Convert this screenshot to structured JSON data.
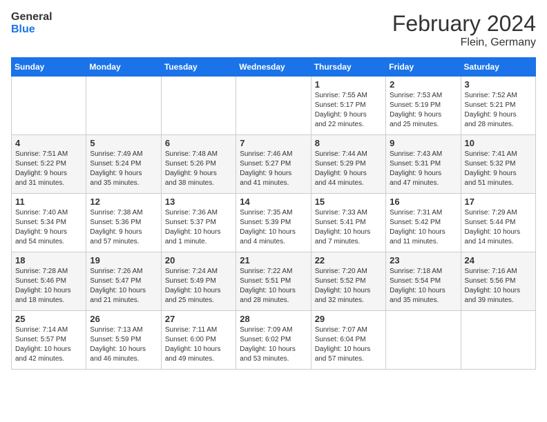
{
  "header": {
    "logo_text_general": "General",
    "logo_text_blue": "Blue",
    "title": "February 2024",
    "subtitle": "Flein, Germany"
  },
  "weekdays": [
    "Sunday",
    "Monday",
    "Tuesday",
    "Wednesday",
    "Thursday",
    "Friday",
    "Saturday"
  ],
  "weeks": [
    {
      "days": [
        {
          "num": "",
          "info": ""
        },
        {
          "num": "",
          "info": ""
        },
        {
          "num": "",
          "info": ""
        },
        {
          "num": "",
          "info": ""
        },
        {
          "num": "1",
          "info": "Sunrise: 7:55 AM\nSunset: 5:17 PM\nDaylight: 9 hours\nand 22 minutes."
        },
        {
          "num": "2",
          "info": "Sunrise: 7:53 AM\nSunset: 5:19 PM\nDaylight: 9 hours\nand 25 minutes."
        },
        {
          "num": "3",
          "info": "Sunrise: 7:52 AM\nSunset: 5:21 PM\nDaylight: 9 hours\nand 28 minutes."
        }
      ]
    },
    {
      "days": [
        {
          "num": "4",
          "info": "Sunrise: 7:51 AM\nSunset: 5:22 PM\nDaylight: 9 hours\nand 31 minutes."
        },
        {
          "num": "5",
          "info": "Sunrise: 7:49 AM\nSunset: 5:24 PM\nDaylight: 9 hours\nand 35 minutes."
        },
        {
          "num": "6",
          "info": "Sunrise: 7:48 AM\nSunset: 5:26 PM\nDaylight: 9 hours\nand 38 minutes."
        },
        {
          "num": "7",
          "info": "Sunrise: 7:46 AM\nSunset: 5:27 PM\nDaylight: 9 hours\nand 41 minutes."
        },
        {
          "num": "8",
          "info": "Sunrise: 7:44 AM\nSunset: 5:29 PM\nDaylight: 9 hours\nand 44 minutes."
        },
        {
          "num": "9",
          "info": "Sunrise: 7:43 AM\nSunset: 5:31 PM\nDaylight: 9 hours\nand 47 minutes."
        },
        {
          "num": "10",
          "info": "Sunrise: 7:41 AM\nSunset: 5:32 PM\nDaylight: 9 hours\nand 51 minutes."
        }
      ]
    },
    {
      "days": [
        {
          "num": "11",
          "info": "Sunrise: 7:40 AM\nSunset: 5:34 PM\nDaylight: 9 hours\nand 54 minutes."
        },
        {
          "num": "12",
          "info": "Sunrise: 7:38 AM\nSunset: 5:36 PM\nDaylight: 9 hours\nand 57 minutes."
        },
        {
          "num": "13",
          "info": "Sunrise: 7:36 AM\nSunset: 5:37 PM\nDaylight: 10 hours\nand 1 minute."
        },
        {
          "num": "14",
          "info": "Sunrise: 7:35 AM\nSunset: 5:39 PM\nDaylight: 10 hours\nand 4 minutes."
        },
        {
          "num": "15",
          "info": "Sunrise: 7:33 AM\nSunset: 5:41 PM\nDaylight: 10 hours\nand 7 minutes."
        },
        {
          "num": "16",
          "info": "Sunrise: 7:31 AM\nSunset: 5:42 PM\nDaylight: 10 hours\nand 11 minutes."
        },
        {
          "num": "17",
          "info": "Sunrise: 7:29 AM\nSunset: 5:44 PM\nDaylight: 10 hours\nand 14 minutes."
        }
      ]
    },
    {
      "days": [
        {
          "num": "18",
          "info": "Sunrise: 7:28 AM\nSunset: 5:46 PM\nDaylight: 10 hours\nand 18 minutes."
        },
        {
          "num": "19",
          "info": "Sunrise: 7:26 AM\nSunset: 5:47 PM\nDaylight: 10 hours\nand 21 minutes."
        },
        {
          "num": "20",
          "info": "Sunrise: 7:24 AM\nSunset: 5:49 PM\nDaylight: 10 hours\nand 25 minutes."
        },
        {
          "num": "21",
          "info": "Sunrise: 7:22 AM\nSunset: 5:51 PM\nDaylight: 10 hours\nand 28 minutes."
        },
        {
          "num": "22",
          "info": "Sunrise: 7:20 AM\nSunset: 5:52 PM\nDaylight: 10 hours\nand 32 minutes."
        },
        {
          "num": "23",
          "info": "Sunrise: 7:18 AM\nSunset: 5:54 PM\nDaylight: 10 hours\nand 35 minutes."
        },
        {
          "num": "24",
          "info": "Sunrise: 7:16 AM\nSunset: 5:56 PM\nDaylight: 10 hours\nand 39 minutes."
        }
      ]
    },
    {
      "days": [
        {
          "num": "25",
          "info": "Sunrise: 7:14 AM\nSunset: 5:57 PM\nDaylight: 10 hours\nand 42 minutes."
        },
        {
          "num": "26",
          "info": "Sunrise: 7:13 AM\nSunset: 5:59 PM\nDaylight: 10 hours\nand 46 minutes."
        },
        {
          "num": "27",
          "info": "Sunrise: 7:11 AM\nSunset: 6:00 PM\nDaylight: 10 hours\nand 49 minutes."
        },
        {
          "num": "28",
          "info": "Sunrise: 7:09 AM\nSunset: 6:02 PM\nDaylight: 10 hours\nand 53 minutes."
        },
        {
          "num": "29",
          "info": "Sunrise: 7:07 AM\nSunset: 6:04 PM\nDaylight: 10 hours\nand 57 minutes."
        },
        {
          "num": "",
          "info": ""
        },
        {
          "num": "",
          "info": ""
        }
      ]
    }
  ]
}
